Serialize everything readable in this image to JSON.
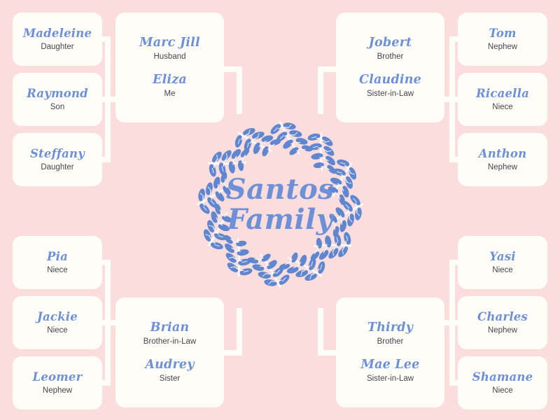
{
  "poster": {
    "title_line1": "Santos",
    "title_line2": "Family",
    "background_color": "#fbdddd",
    "card_color": "#fffdf8",
    "name_color": "#6d90d6",
    "role_color": "#45454b",
    "leaf_color": "#5f86cf",
    "stem_color": "#fffdf8"
  },
  "branches": {
    "top_left": {
      "couple": [
        {
          "name": "Marc Jill",
          "role": "Husband"
        },
        {
          "name": "Eliza",
          "role": "Me"
        }
      ],
      "children": [
        {
          "name": "Madeleine",
          "role": "Daughter"
        },
        {
          "name": "Raymond",
          "role": "Son"
        },
        {
          "name": "Steffany",
          "role": "Daughter"
        }
      ]
    },
    "top_right": {
      "couple": [
        {
          "name": "Jobert",
          "role": "Brother"
        },
        {
          "name": "Claudine",
          "role": "Sister-in-Law"
        }
      ],
      "children": [
        {
          "name": "Tom",
          "role": "Nephew"
        },
        {
          "name": "Ricaella",
          "role": "Niece"
        },
        {
          "name": "Anthon",
          "role": "Nephew"
        }
      ]
    },
    "bottom_left": {
      "couple": [
        {
          "name": "Brian",
          "role": "Brother-in-Law"
        },
        {
          "name": "Audrey",
          "role": "Sister"
        }
      ],
      "children": [
        {
          "name": "Pia",
          "role": "Niece"
        },
        {
          "name": "Jackie",
          "role": "Niece"
        },
        {
          "name": "Leomer",
          "role": "Nephew"
        }
      ]
    },
    "bottom_right": {
      "couple": [
        {
          "name": "Thirdy",
          "role": "Brother"
        },
        {
          "name": "Mae Lee",
          "role": "Sister-in-Law"
        }
      ],
      "children": [
        {
          "name": "Yasi",
          "role": "Niece"
        },
        {
          "name": "Charles",
          "role": "Nephew"
        },
        {
          "name": "Shamane",
          "role": "Niece"
        }
      ]
    }
  }
}
